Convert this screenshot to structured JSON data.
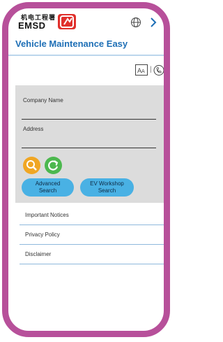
{
  "header": {
    "logo_text": "EMSD",
    "logo_cn": "机电工程署",
    "title": "Vehicle Maintenance Easy"
  },
  "search": {
    "company_label": "Company Name",
    "address_label": "Address",
    "advanced_line1": "Advanced",
    "advanced_line2": "Search",
    "ev_line1": "EV Workshop",
    "ev_line2": "Search"
  },
  "links": [
    {
      "label": "Important Notices"
    },
    {
      "label": "Privacy Policy"
    },
    {
      "label": "Disclaimer"
    }
  ],
  "colors": {
    "frame": "#b7509a",
    "title": "#1e6fb6",
    "search_button": "#f0a623",
    "reset_button": "#4cb84e",
    "pill_button": "#49b1e4",
    "logo_badge": "#e0302c"
  },
  "icons": [
    "globe-icon",
    "chevron-right-icon",
    "font-size-icon",
    "phone-icon",
    "search-icon",
    "reset-icon"
  ]
}
